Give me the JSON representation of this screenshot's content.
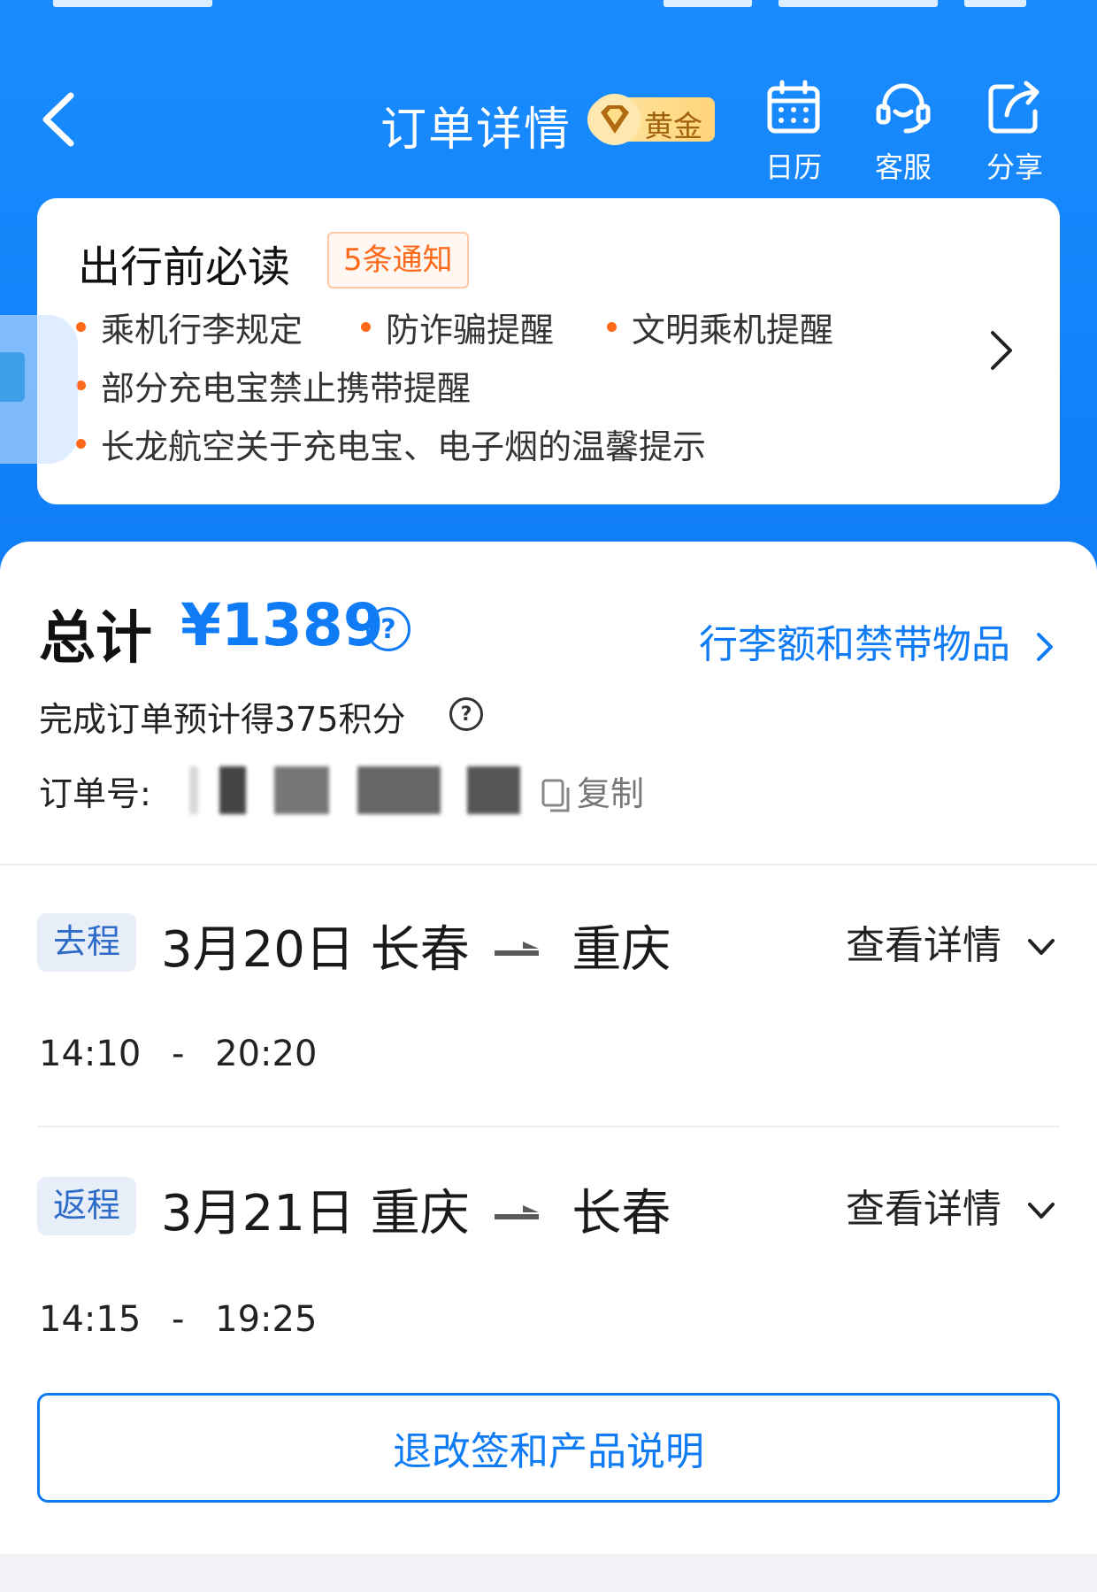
{
  "header": {
    "title": "订单详情",
    "member_level": "黄金",
    "nav": [
      {
        "label": "日历",
        "icon": "calendar-icon"
      },
      {
        "label": "客服",
        "icon": "headset-icon"
      },
      {
        "label": "分享",
        "icon": "share-icon"
      }
    ]
  },
  "notice": {
    "title": "出行前必读",
    "count": "5条通知",
    "items": [
      "乘机行李规定",
      "防诈骗提醒",
      "文明乘机提醒",
      "部分充电宝禁止携带提醒",
      "长龙航空关于充电宝、电子烟的温馨提示"
    ]
  },
  "order": {
    "total_label": "总计",
    "total_amount": "¥1389",
    "baggage_link": "行李额和禁带物品",
    "points_text": "完成订单预计得375积分",
    "order_no_label": "订单号:",
    "copy_label": "复制"
  },
  "trips": [
    {
      "tag": "去程",
      "date": "3月20日",
      "from": "长春",
      "to": "重庆",
      "detail": "查看详情",
      "time_dep": "14:10",
      "time_arr": "20:20"
    },
    {
      "tag": "返程",
      "date": "3月21日",
      "from": "重庆",
      "to": "长春",
      "detail": "查看详情",
      "time_dep": "14:15",
      "time_arr": "19:25"
    }
  ],
  "policy_button": "退改签和产品说明",
  "colors": {
    "brand_blue": "#0f7cf5",
    "accent_orange": "#ff6a1a",
    "gold": "#a0620a"
  }
}
